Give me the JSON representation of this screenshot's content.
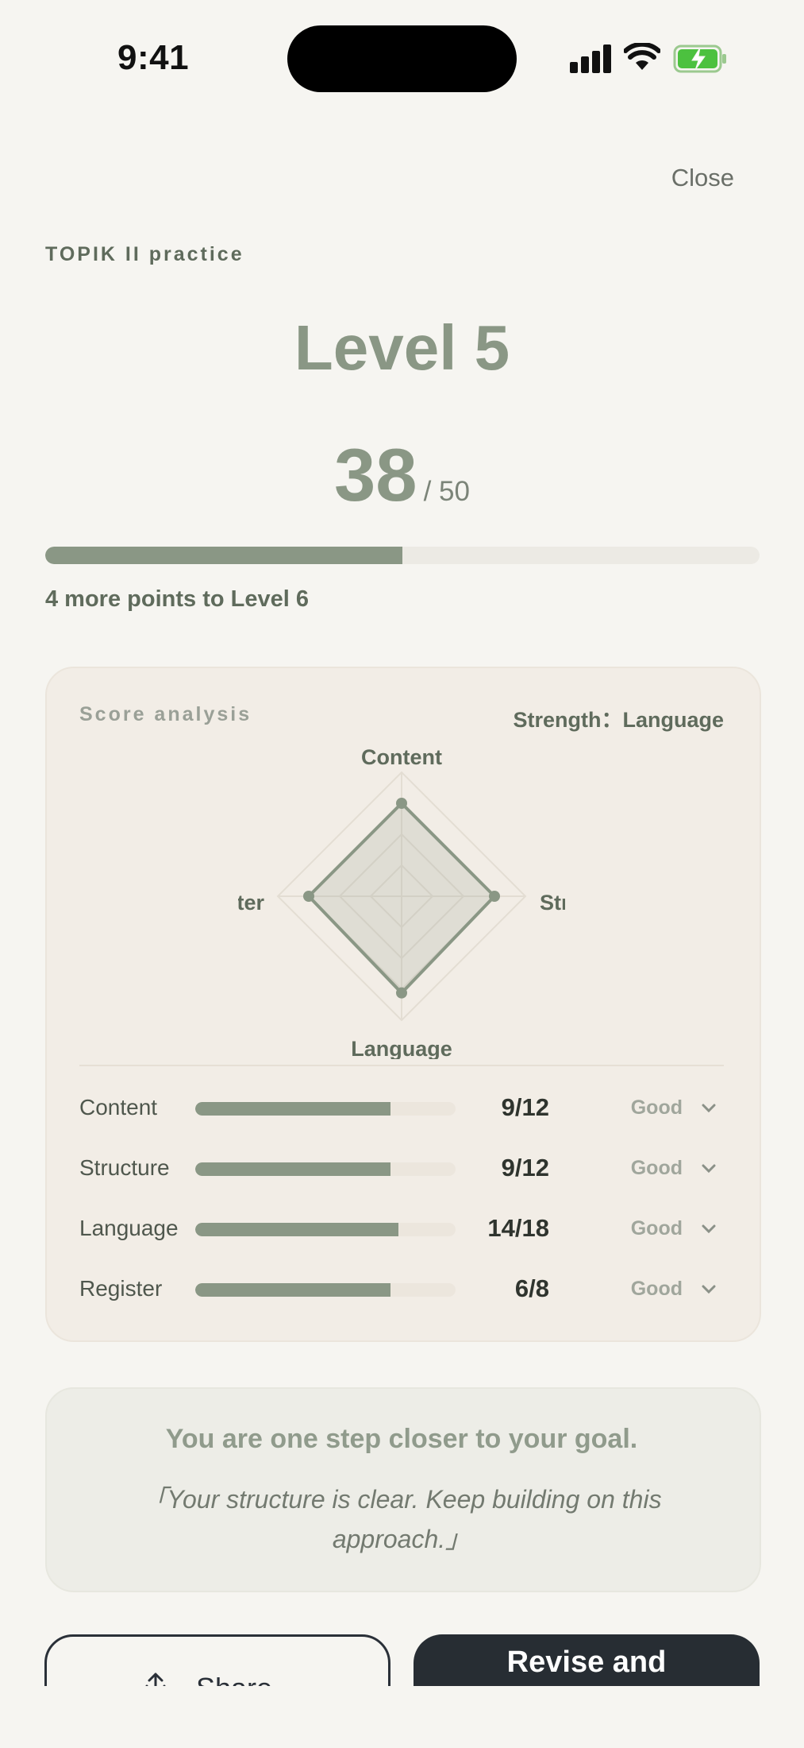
{
  "status_bar": {
    "time": "9:41"
  },
  "header": {
    "close_label": "Close"
  },
  "result": {
    "exam_label": "TOPIK II practice",
    "level": "Level 5",
    "score": "38",
    "score_total": "/ 50",
    "progress_fraction": 0.5,
    "next_level_text": "4 more points to Level 6"
  },
  "analysis": {
    "title": "Score analysis",
    "strength": "Strength：Language",
    "radar_axes": [
      "Content",
      "Structure",
      "Language",
      "Register"
    ],
    "radar_values": [
      0.75,
      0.75,
      0.78,
      0.75
    ],
    "rows": [
      {
        "label": "Content",
        "score": "9/12",
        "fraction": 0.75,
        "grade": "Good"
      },
      {
        "label": "Structure",
        "score": "9/12",
        "fraction": 0.75,
        "grade": "Good"
      },
      {
        "label": "Language",
        "score": "14/18",
        "fraction": 0.78,
        "grade": "Good"
      },
      {
        "label": "Register",
        "score": "6/8",
        "fraction": 0.75,
        "grade": "Good"
      }
    ]
  },
  "feedback": {
    "headline": "You are one step closer to your goal.",
    "quote": "「Your structure is clear. Keep building on this approach.」"
  },
  "actions": {
    "share_label": "Share",
    "revise_label": "Revise and"
  },
  "colors": {
    "accent": "#8a9785",
    "dark_button": "#272d33",
    "background": "#f6f5f1"
  }
}
